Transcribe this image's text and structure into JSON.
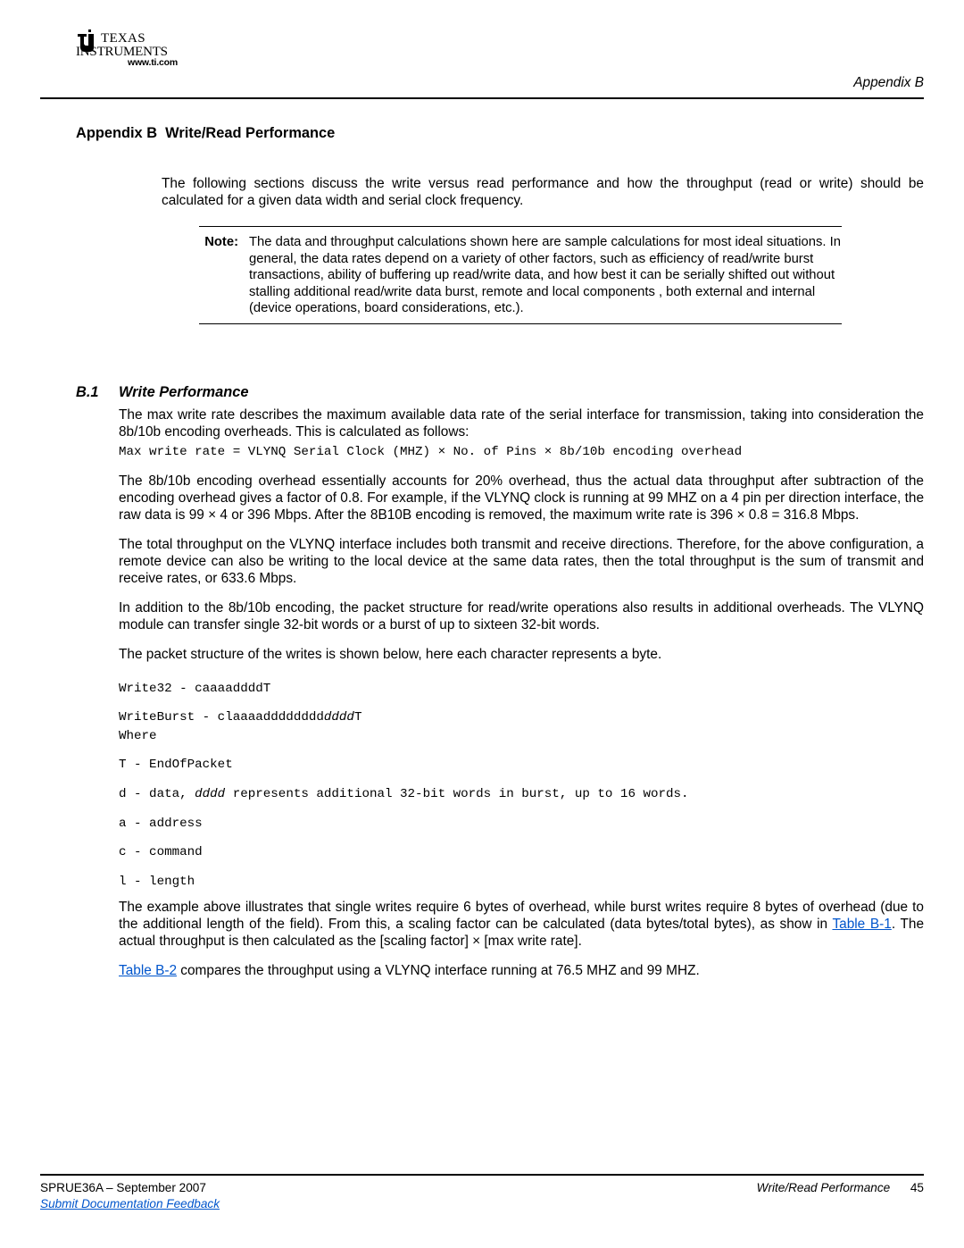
{
  "logo": {
    "brand_line1": "TEXAS",
    "brand_line2": "INSTRUMENTS",
    "url": "www.ti.com"
  },
  "header": {
    "right_label": "Appendix B"
  },
  "appendix_title": {
    "prefix": "Appendix B",
    "title": "Write/Read Performance"
  },
  "intro": "The following sections discuss the write versus read performance and how the throughput (read or write) should be calculated for a given data width and serial clock frequency.",
  "note": {
    "label": "Note:",
    "text": "The data and throughput calculations shown here are sample calculations for most ideal situations. In general, the data rates depend on a variety of other factors, such as efficiency of read/write burst transactions, ability of buffering up read/write data, and how best it can be serially shifted out without stalling additional read/write data burst, remote and local components , both external and internal (device operations, board considerations, etc.)."
  },
  "section": {
    "num": "B.1",
    "title": "Write Performance"
  },
  "p1": "The max write rate describes the maximum available data rate of the serial interface for transmission, taking into consideration the 8b/10b encoding overheads. This is calculated as follows:",
  "formula": "Max write rate = VLYNQ Serial Clock (MHZ) × No. of Pins × 8b/10b encoding overhead",
  "p2": "The 8b/10b encoding overhead essentially accounts for 20% overhead, thus the actual data throughput after subtraction of the encoding overhead gives a factor of 0.8. For example, if the VLYNQ clock is running at 99 MHZ on a 4 pin per direction interface, the raw data is 99 × 4 or 396 Mbps. After the 8B10B encoding is removed, the maximum write rate is 396 × 0.8 = 316.8 Mbps.",
  "p3": "The total throughput on the VLYNQ interface includes both transmit and receive directions. Therefore, for the above configuration, a remote device can also be writing to the local device at the same data rates, then the total throughput is the sum of transmit and receive rates, or 633.6 Mbps.",
  "p4": "In addition to the 8b/10b encoding, the packet structure for read/write operations also results in additional overheads. The VLYNQ module can transfer single 32-bit words or a burst of up to sixteen 32-bit words.",
  "p5": "The packet structure of the writes is shown below, here each character represents a byte.",
  "code": {
    "l1": "Write32 - caaaaddddT",
    "l2a": "WriteBurst - claaaadddddddd",
    "l2b": "dddd",
    "l2c": "T",
    "l3": "Where",
    "l4": "T - EndOfPacket",
    "l5a": "d - data, ",
    "l5b": "dddd",
    "l5c": " represents additional 32-bit words in burst, up to 16 words.",
    "l6": "a - address",
    "l7": "c - command",
    "l8": "l  - length"
  },
  "p6a": "The example above illustrates that single writes require 6 bytes of overhead, while burst writes require 8 bytes of overhead (due to the additional length of the field). From this, a scaling factor can be calculated (data bytes/total bytes), as show in ",
  "p6link": "Table B-1",
  "p6b": ". The actual throughput is then calculated as the [scaling factor] × [max write rate].",
  "p7link": "Table B-2",
  "p7b": " compares the throughput using a VLYNQ interface running at 76.5 MHZ and 99 MHZ.",
  "footer": {
    "left": "SPRUE36A – September 2007",
    "right_title": "Write/Read Performance",
    "page": "45",
    "feedback": "Submit Documentation Feedback"
  }
}
